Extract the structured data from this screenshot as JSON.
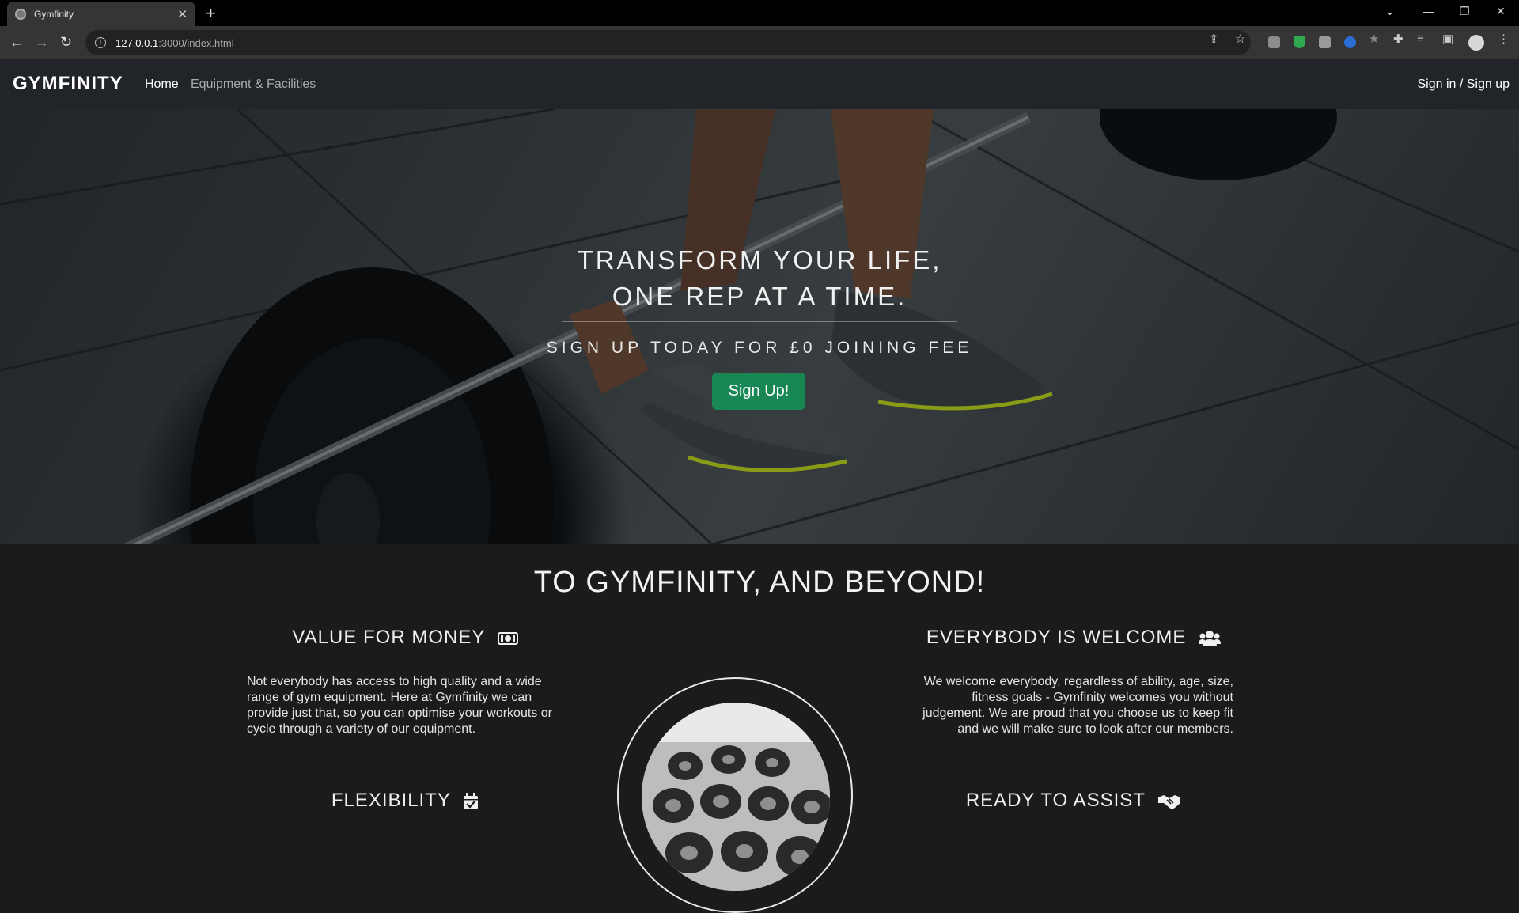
{
  "browser": {
    "tab_title": "Gymfinity",
    "url_host": "127.0.0.1",
    "url_path": ":3000/index.html"
  },
  "nav": {
    "brand": "GYMFINITY",
    "links": [
      "Home",
      "Equipment & Facilities"
    ],
    "signin": "Sign in / Sign up"
  },
  "hero": {
    "line1": "TRANSFORM YOUR LIFE,",
    "line2": "ONE REP AT A TIME.",
    "subtitle": "SIGN UP TODAY FOR £0 JOINING FEE",
    "button": "Sign Up!"
  },
  "section": {
    "headline": "TO GYMFINITY, AND BEYOND!",
    "features": [
      {
        "title": "VALUE FOR MONEY",
        "icon": "money-bill-icon",
        "text": "Not everybody has access to high quality and a wide range of gym equipment. Here at Gymfinity we can provide just that, so you can optimise your workouts or cycle through a variety of our equipment."
      },
      {
        "title": "EVERYBODY IS WELCOME",
        "icon": "users-icon",
        "text": "We welcome everybody, regardless of ability, age, size, fitness goals - Gymfinity welcomes you without judgement. We are proud that you choose us to keep fit and we will make sure to look after our members."
      },
      {
        "title": "FLEXIBILITY",
        "icon": "calendar-check-icon"
      },
      {
        "title": "READY TO ASSIST",
        "icon": "handshake-icon"
      }
    ]
  },
  "colors": {
    "accent": "#198754",
    "navbar": "#212529",
    "page": "#1b1b1b"
  }
}
